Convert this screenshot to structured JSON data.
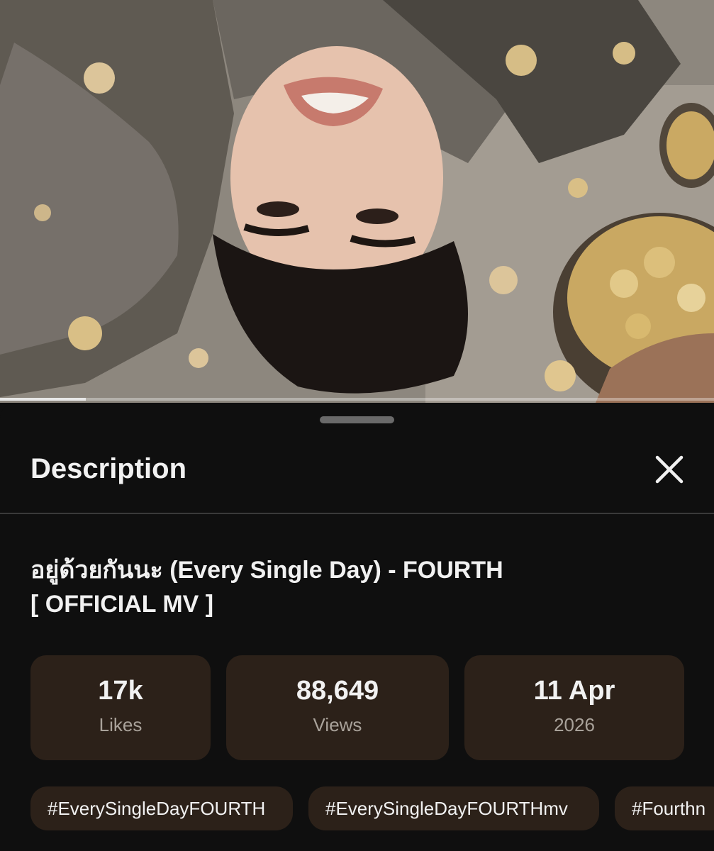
{
  "video": {
    "progress_fraction": 0.12
  },
  "sheet": {
    "title": "Description",
    "close_icon": "close-icon"
  },
  "video_info": {
    "title_line1": "อยู่ด้วยกันนะ (Every Single Day) - FOURTH",
    "title_line2": "[ OFFICIAL MV ]"
  },
  "stats": [
    {
      "value": "17k",
      "label": "Likes"
    },
    {
      "value": "88,649",
      "label": "Views"
    },
    {
      "value": "11 Apr",
      "label": "2026"
    }
  ],
  "hashtags": [
    "#EverySingleDayFOURTH",
    "#EverySingleDayFOURTHmv",
    "#Fourthn"
  ],
  "colors": {
    "background": "#0f0f0f",
    "card": "#2c2119",
    "secondary_text": "#a9a29a",
    "divider": "#3a3a3a"
  }
}
